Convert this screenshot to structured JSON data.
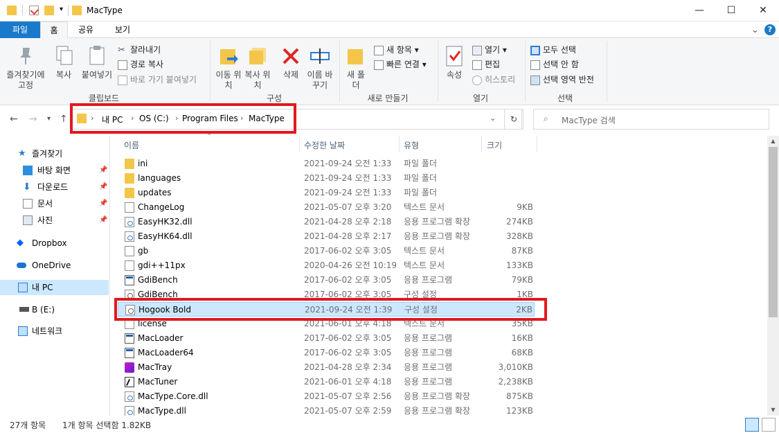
{
  "window": {
    "title": "MacType",
    "minimize": "—",
    "maximize": "☐",
    "close": "✕"
  },
  "tabs": {
    "file": "파일",
    "home": "홈",
    "share": "공유",
    "view": "보기",
    "expand": "⌄",
    "help": "?"
  },
  "ribbon": {
    "clipboard": {
      "pin": "즐겨찾기에 고정",
      "copy": "복사",
      "paste": "붙여넣기",
      "cut": "잘라내기",
      "copy_path": "경로 복사",
      "paste_shortcut": "바로 가기 붙여넣기",
      "label": "클립보드"
    },
    "organize": {
      "move_to": "이동 위치",
      "copy_to": "복사 위치",
      "delete": "삭제",
      "rename": "이름 바꾸기",
      "label": "구성"
    },
    "new": {
      "new_folder": "새 폴더",
      "new_item": "새 항목",
      "easy_access": "빠른 연결",
      "label": "새로 만들기"
    },
    "open": {
      "properties": "속성",
      "open": "열기",
      "edit": "편집",
      "history": "히스토리",
      "label": "열기"
    },
    "select": {
      "select_all": "모두 선택",
      "select_none": "선택 안 함",
      "invert": "선택 영역 반전",
      "label": "선택"
    }
  },
  "address": {
    "crumbs": [
      "내 PC",
      "OS (C:)",
      "Program Files",
      "MacType"
    ],
    "search_placeholder": "MacType 검색"
  },
  "nav": {
    "quick_access": "즐겨찾기",
    "desktop": "바탕 화면",
    "downloads": "다운로드",
    "documents": "문서",
    "pictures": "사진",
    "dropbox": "Dropbox",
    "onedrive": "OneDrive",
    "this_pc": "내 PC",
    "drive_b": "B (E:)",
    "network": "네트워크"
  },
  "columns": {
    "name": "이름",
    "date": "수정한 날짜",
    "type": "유형",
    "size": "크기"
  },
  "files": [
    {
      "name": "ini",
      "date": "2021-09-24 오전 1:33",
      "type": "파일 폴더",
      "size": "",
      "icon": "folder-icon"
    },
    {
      "name": "languages",
      "date": "2021-09-24 오전 1:33",
      "type": "파일 폴더",
      "size": "",
      "icon": "folder-icon"
    },
    {
      "name": "updates",
      "date": "2021-09-24 오전 1:33",
      "type": "파일 폴더",
      "size": "",
      "icon": "folder-icon"
    },
    {
      "name": "ChangeLog",
      "date": "2021-05-07 오후 3:20",
      "type": "텍스트 문서",
      "size": "9KB",
      "icon": "text-file-icon"
    },
    {
      "name": "EasyHK32.dll",
      "date": "2021-04-28 오후 2:18",
      "type": "응용 프로그램 확장",
      "size": "274KB",
      "icon": "dll-file-icon"
    },
    {
      "name": "EasyHK64.dll",
      "date": "2021-04-28 오후 2:17",
      "type": "응용 프로그램 확장",
      "size": "328KB",
      "icon": "dll-file-icon"
    },
    {
      "name": "gb",
      "date": "2017-06-02 오후 3:05",
      "type": "텍스트 문서",
      "size": "87KB",
      "icon": "text-file-icon"
    },
    {
      "name": "gdi++11px",
      "date": "2020-04-26 오전 10:19",
      "type": "텍스트 문서",
      "size": "133KB",
      "icon": "text-file-icon"
    },
    {
      "name": "GdiBench",
      "date": "2017-06-02 오후 3:05",
      "type": "응용 프로그램",
      "size": "79KB",
      "icon": "application-icon"
    },
    {
      "name": "GdiBench",
      "date": "2017-06-02 오후 3:05",
      "type": "구성 설정",
      "size": "1KB",
      "icon": "config-file-icon"
    },
    {
      "name": "Hogook Bold",
      "date": "2021-09-24 오전 1:39",
      "type": "구성 설정",
      "size": "2KB",
      "icon": "config-file-icon"
    },
    {
      "name": "license",
      "date": "2021-06-01 오후 4:18",
      "type": "텍스트 문서",
      "size": "35KB",
      "icon": "text-file-icon"
    },
    {
      "name": "MacLoader",
      "date": "2017-06-02 오후 3:05",
      "type": "응용 프로그램",
      "size": "16KB",
      "icon": "application-icon"
    },
    {
      "name": "MacLoader64",
      "date": "2017-06-02 오후 3:05",
      "type": "응용 프로그램",
      "size": "68KB",
      "icon": "application-icon"
    },
    {
      "name": "MacTray",
      "date": "2021-04-28 오후 2:34",
      "type": "응용 프로그램",
      "size": "3,010KB",
      "icon": "mactray-icon"
    },
    {
      "name": "MacTuner",
      "date": "2021-06-01 오후 4:18",
      "type": "응용 프로그램",
      "size": "2,238KB",
      "icon": "mactuner-icon"
    },
    {
      "name": "MacType.Core.dll",
      "date": "2021-05-07 오후 2:56",
      "type": "응용 프로그램 확장",
      "size": "875KB",
      "icon": "dll-file-icon"
    },
    {
      "name": "MacType.dll",
      "date": "2021-05-07 오후 2:59",
      "type": "응용 프로그램 확장",
      "size": "123KB",
      "icon": "dll-file-icon"
    }
  ],
  "selected_row": 10,
  "status": {
    "item_count": "27개 항목",
    "selection": "1개 항목 선택함 1.82KB"
  },
  "colors": {
    "accent": "#1979ca",
    "selection": "#cce8ff",
    "highlight_box": "#e0191f"
  }
}
